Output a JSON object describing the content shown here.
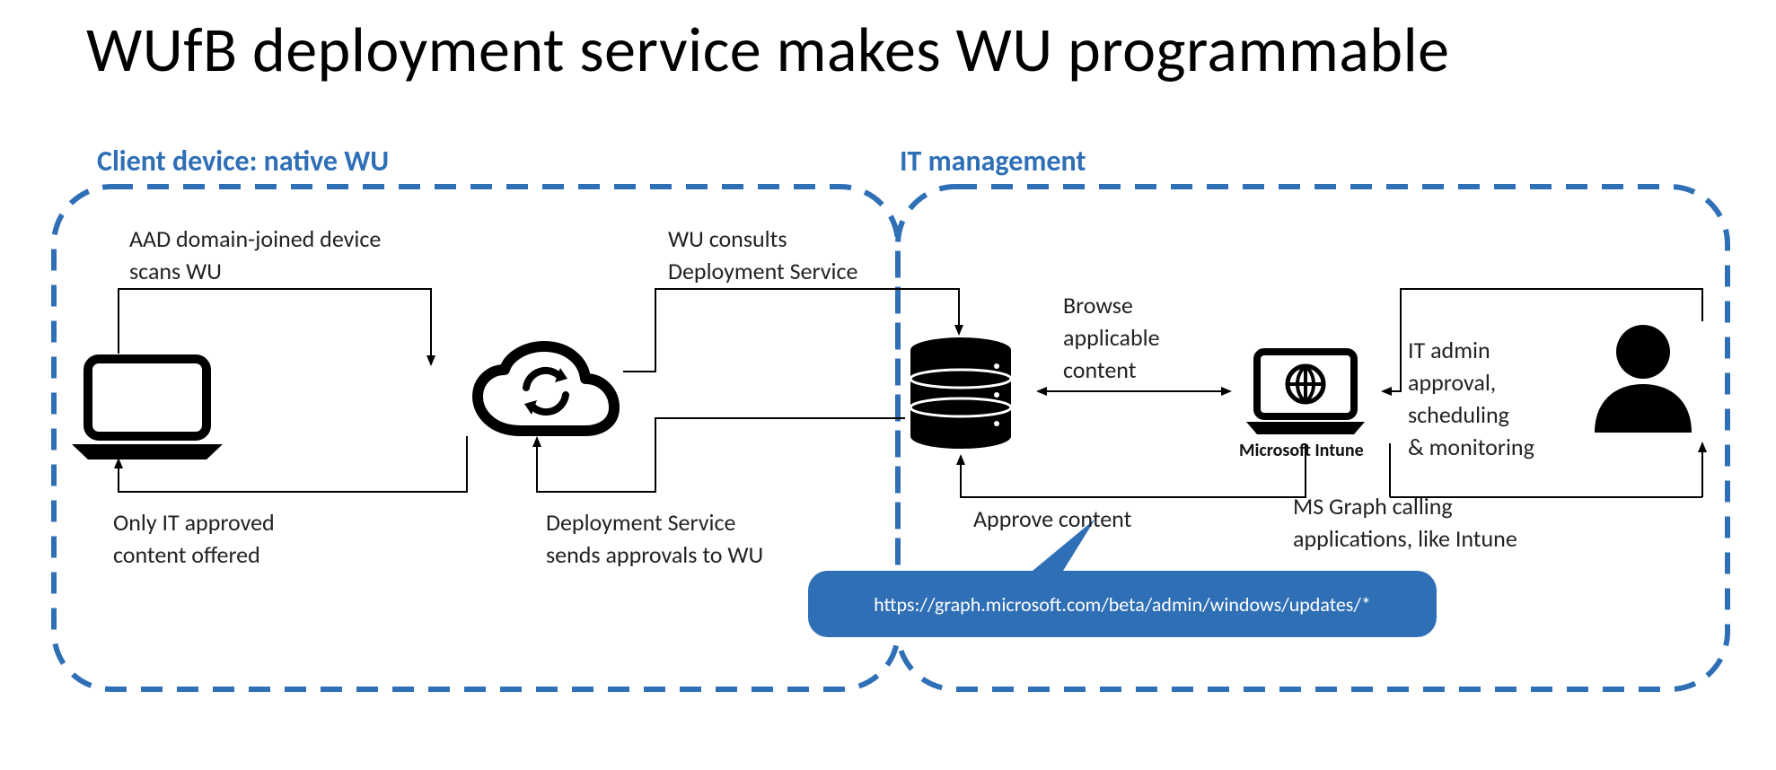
{
  "title": "WUfB deployment service makes WU programmable",
  "sections": {
    "left": "Client device: native WU",
    "right": "IT management"
  },
  "labels": {
    "aad_scan_line1": "AAD domain-joined device",
    "aad_scan_line2": "scans WU",
    "wu_consults_line1": "WU consults",
    "wu_consults_line2": "Deployment Service",
    "approved_offered_line1": "Only IT approved",
    "approved_offered_line2": "content offered",
    "sends_approvals_line1": "Deployment Service",
    "sends_approvals_line2": "sends approvals to WU",
    "browse_line1": "Browse",
    "browse_line2": "applicable",
    "browse_line3": "content",
    "approve_content": "Approve content",
    "it_admin_line1": "IT admin",
    "it_admin_line2": "approval,",
    "it_admin_line3": "scheduling",
    "it_admin_line4": "& monitoring",
    "ms_graph_line1": "MS Graph calling",
    "ms_graph_line2": "applications, like Intune",
    "intune": "Microsoft Intune",
    "graph_url": "https://graph.microsoft.com/beta/admin/windows/updates/*"
  }
}
